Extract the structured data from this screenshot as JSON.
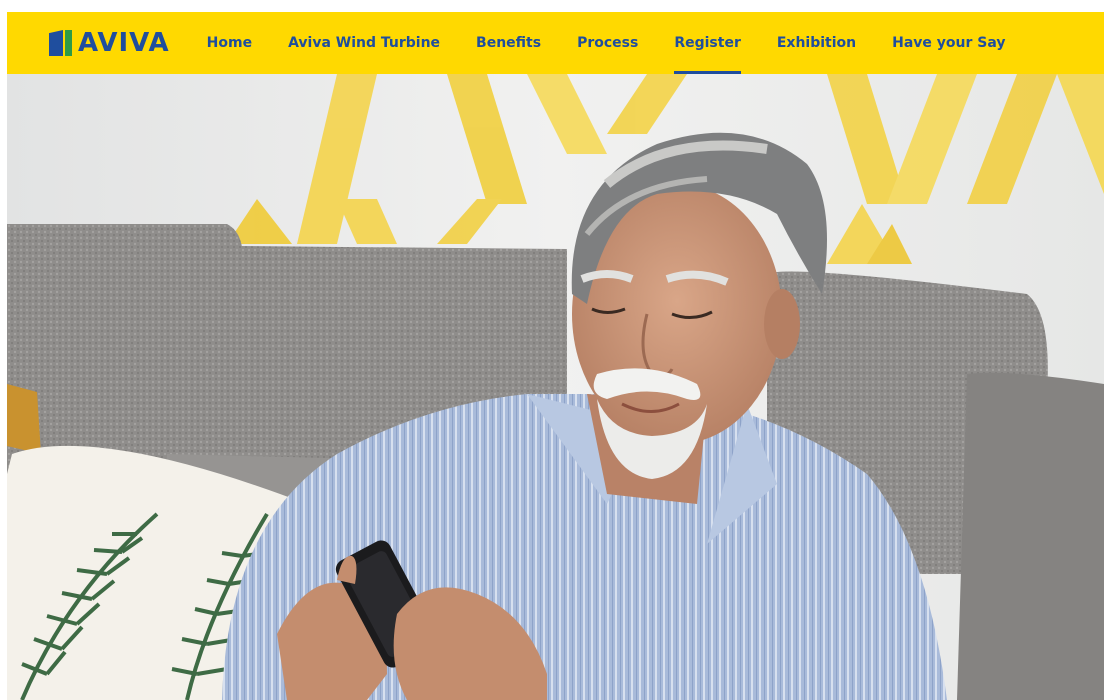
{
  "brand": {
    "name": "AVIVA",
    "colors": {
      "yellow": "#FFD900",
      "blue": "#1F4E9E",
      "green": "#2E9A47"
    }
  },
  "nav": {
    "items": [
      {
        "label": "Home",
        "active": false
      },
      {
        "label": "Aviva Wind Turbine",
        "active": false
      },
      {
        "label": "Benefits",
        "active": false
      },
      {
        "label": "Process",
        "active": false
      },
      {
        "label": "Register",
        "active": true
      },
      {
        "label": "Exhibition",
        "active": false
      },
      {
        "label": "Have your Say",
        "active": false
      }
    ]
  },
  "hero": {
    "image": "man-on-sofa-using-phone-photo"
  }
}
